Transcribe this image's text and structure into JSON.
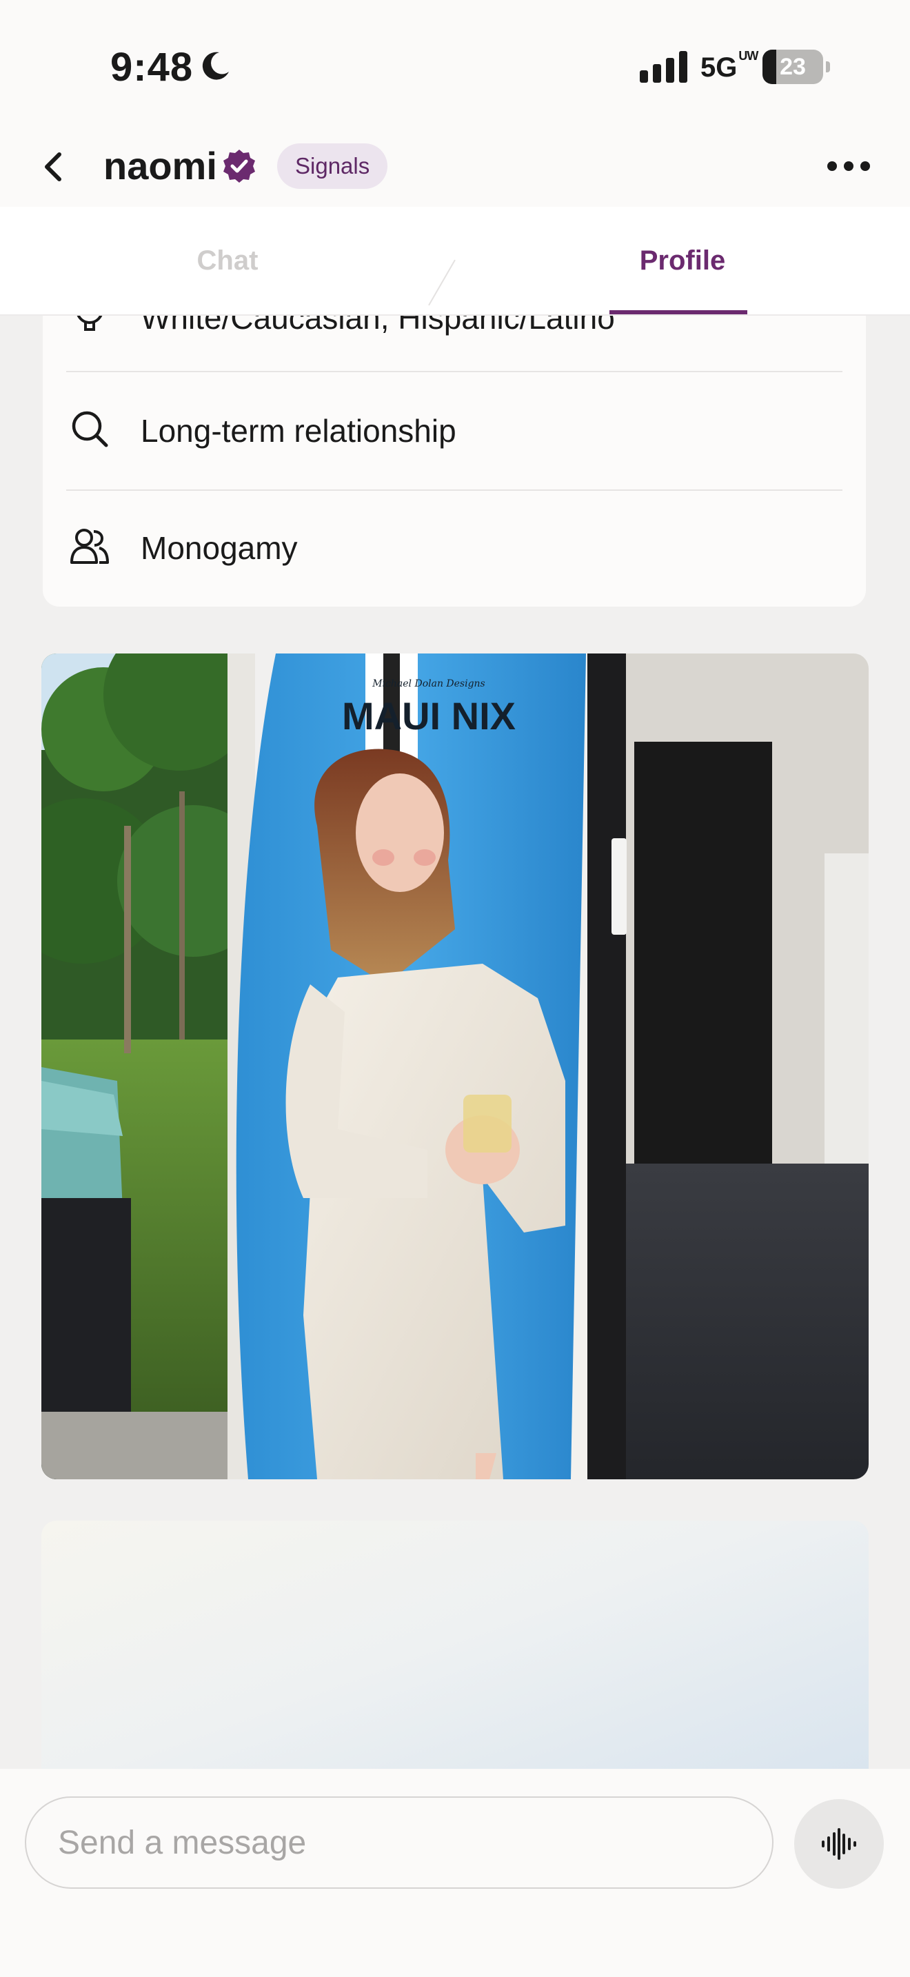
{
  "status_bar": {
    "time": "9:48",
    "network": "5G",
    "network_suffix": "UW",
    "battery_level": "23",
    "battery_fraction": 0.23,
    "icons": [
      "moon-icon",
      "signal-bars-icon",
      "battery-icon"
    ]
  },
  "header": {
    "name": "naomi",
    "badge": "Signals",
    "icons": [
      "back-chevron-icon",
      "verified-badge-icon",
      "more-dots-icon"
    ],
    "accent_color": "#6b2a6f"
  },
  "tabs": [
    {
      "label": "Chat",
      "active": false
    },
    {
      "label": "Profile",
      "active": true
    }
  ],
  "profile": {
    "details": [
      {
        "icon": "ethnicity-icon",
        "text": "White/Caucasian, Hispanic/Latino"
      },
      {
        "icon": "search-icon",
        "text": "Long-term relationship"
      },
      {
        "icon": "people-icon",
        "text": "Monogamy"
      }
    ],
    "photos": [
      {
        "surfboard_text": "MAUI NIX",
        "surfboard_small_text": "Michael Dolan Designs"
      },
      {}
    ]
  },
  "composer": {
    "placeholder": "Send a message",
    "voice_icon": "voice-waveform-icon"
  }
}
